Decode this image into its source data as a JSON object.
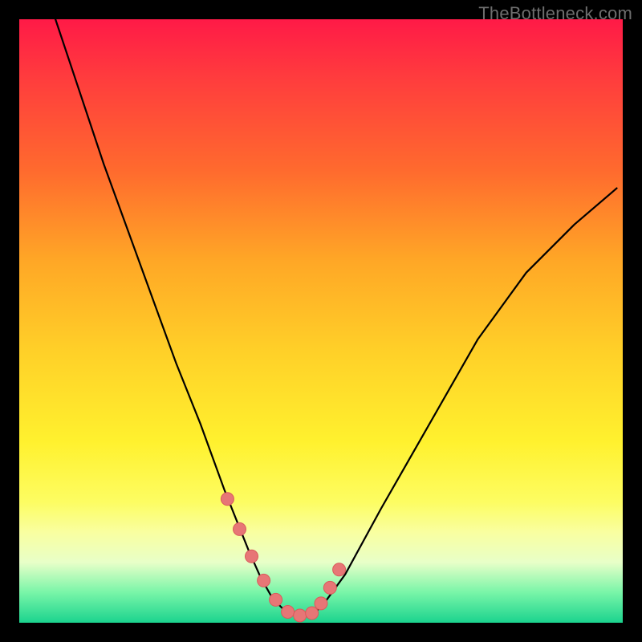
{
  "watermark": "TheBottleneck.com",
  "colors": {
    "curve": "#000000",
    "marker_fill": "#e77676",
    "marker_stroke": "#d95b5b",
    "gradient_top": "#ff1a47",
    "gradient_bottom": "#1bd38e"
  },
  "chart_data": {
    "type": "line",
    "title": "",
    "xlabel": "",
    "ylabel": "",
    "xlim": [
      0,
      100
    ],
    "ylim": [
      0,
      100
    ],
    "note": "Axes unlabeled in source image; x/y values are normalized 0–100 from visual geometry (left-to-right, bottom-to-top).",
    "series": [
      {
        "name": "curve",
        "x": [
          6,
          10,
          14,
          18,
          22,
          26,
          30,
          34,
          36,
          38,
          40,
          42,
          44,
          46,
          48,
          50,
          54,
          60,
          68,
          76,
          84,
          92,
          99
        ],
        "y": [
          100,
          88,
          76,
          65,
          54,
          43,
          33,
          22,
          17,
          12,
          7.5,
          4,
          2,
          1.2,
          1.2,
          2.5,
          8,
          19,
          33,
          47,
          58,
          66,
          72
        ]
      }
    ],
    "markers": {
      "name": "highlight-dots",
      "x": [
        34.5,
        36.5,
        38.5,
        40.5,
        42.5,
        44.5,
        46.5,
        48.5,
        50.0,
        51.5,
        53.0
      ],
      "y": [
        20.5,
        15.5,
        11.0,
        7.0,
        3.8,
        1.8,
        1.2,
        1.6,
        3.2,
        5.8,
        8.8
      ]
    }
  }
}
